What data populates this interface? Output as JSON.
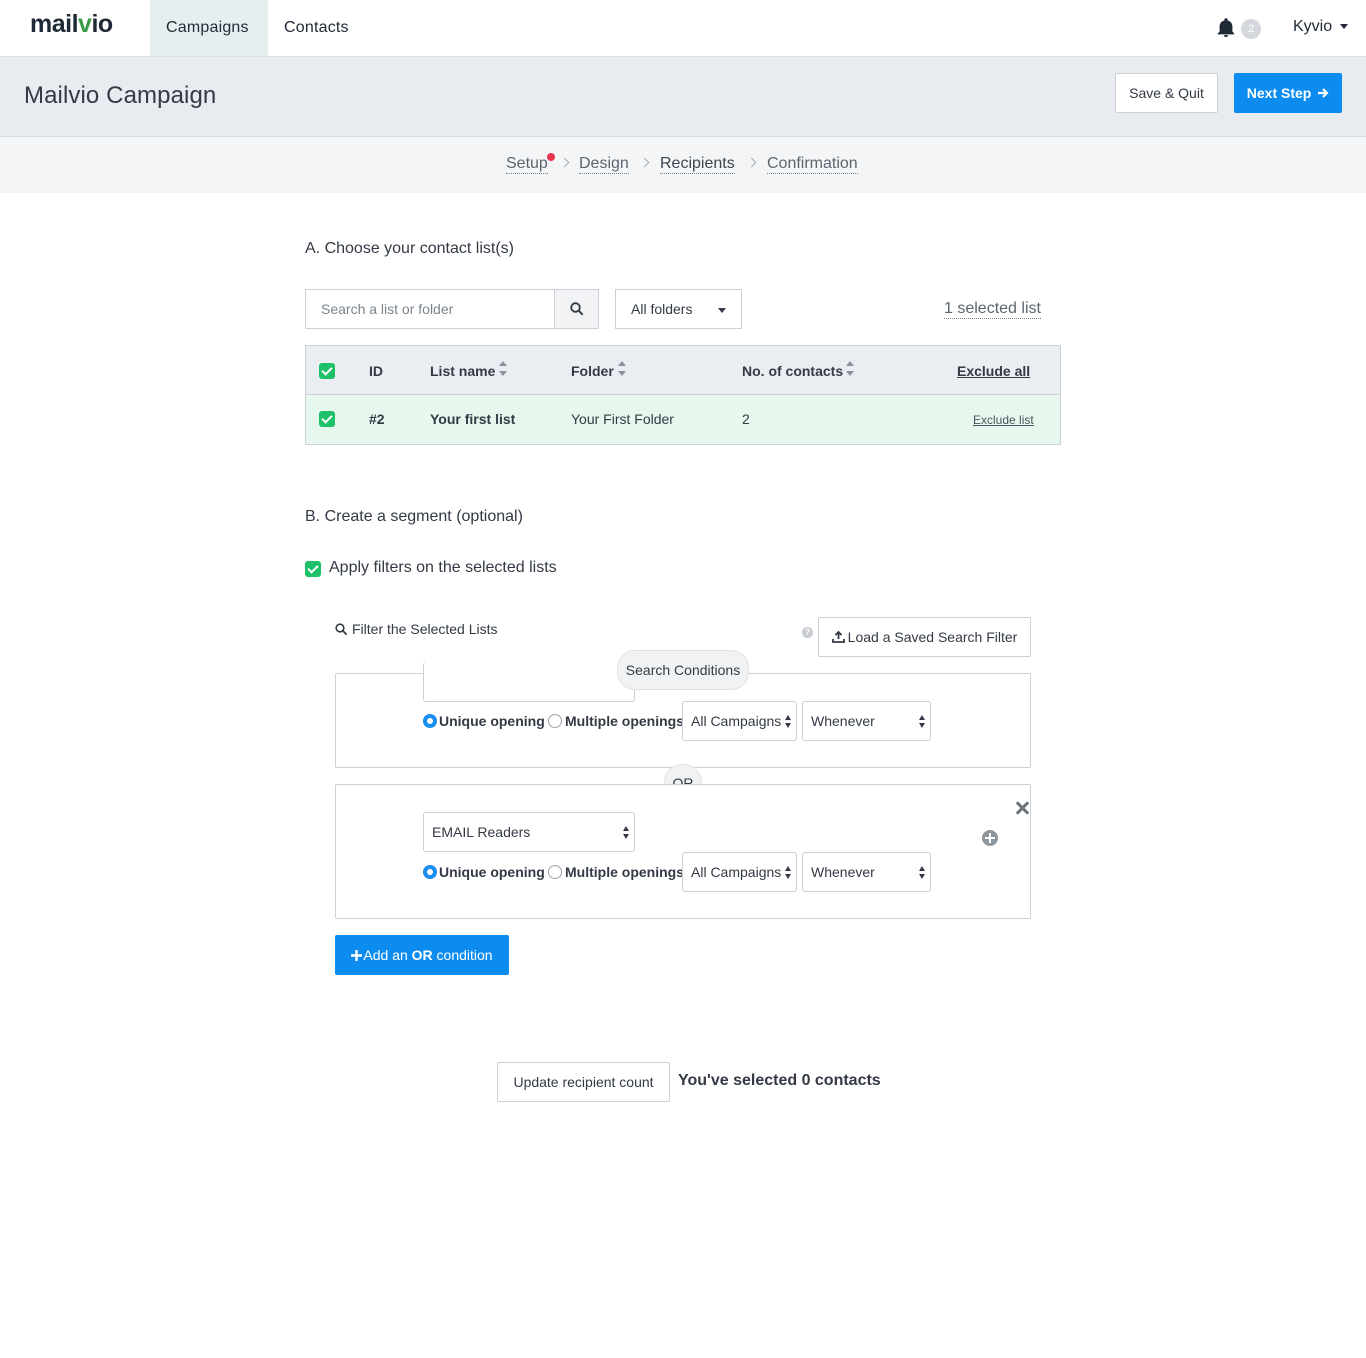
{
  "nav": {
    "logo_main": "mail",
    "logo_accent": "v",
    "logo_end": "io",
    "tabs": [
      {
        "label": "Campaigns",
        "active": true
      },
      {
        "label": "Contacts",
        "active": false
      }
    ],
    "notification_count": "2",
    "user_name": "Kyvio",
    "bell_icon": "bell-icon"
  },
  "header": {
    "title": "Mailvio Campaign",
    "save_quit_label": "Save & Quit",
    "next_step_label": "Next Step",
    "next_icon": "arrow-right-icon",
    "accent_color": "#0d8cf0"
  },
  "steps": [
    {
      "label": "Setup",
      "alert": true
    },
    {
      "label": "Design"
    },
    {
      "label": "Recipients",
      "current": true
    },
    {
      "label": "Confirmation"
    }
  ],
  "section_a": {
    "title": "A. Choose your contact list(s)",
    "search_placeholder": "Search a list or folder",
    "folder_select": "All folders",
    "selected_count_label": "1 selected list",
    "table": {
      "headers": [
        "ID",
        "List name",
        "Folder",
        "No. of contacts"
      ],
      "exclude_all_label": "Exclude all",
      "rows": [
        {
          "id": "#2",
          "name": "Your first list",
          "folder": "Your First Folder",
          "contacts": "2",
          "action": "Exclude list",
          "checked": true
        }
      ],
      "row_highlight_color": "#e6f7ed",
      "check_color": "#1ec16a"
    }
  },
  "section_b": {
    "title": "B. Create a segment (optional)",
    "apply_label": "Apply filters on the selected lists",
    "apply_checked": true,
    "filter_title": "Filter the Selected Lists",
    "help_icon": "?",
    "load_filter_label": "Load a Saved Search Filter",
    "conditions_pill": "Search Conditions",
    "or_label": "OR",
    "conditions": [
      {
        "type_select": "",
        "unique_label": "Unique opening",
        "multiple_label": "Multiple openings",
        "unique_selected": true,
        "campaign_select": "All Campaigns",
        "time_select": "Whenever"
      },
      {
        "type_select": "EMAIL Readers",
        "unique_label": "Unique opening",
        "multiple_label": "Multiple openings",
        "unique_selected": true,
        "campaign_select": "All Campaigns",
        "time_select": "Whenever"
      }
    ],
    "add_or_prefix": "Add an ",
    "add_or_bold": "OR",
    "add_or_suffix": " condition"
  },
  "footer": {
    "update_count_label": "Update recipient count",
    "selected_contacts_label": "You've selected 0 contacts"
  }
}
